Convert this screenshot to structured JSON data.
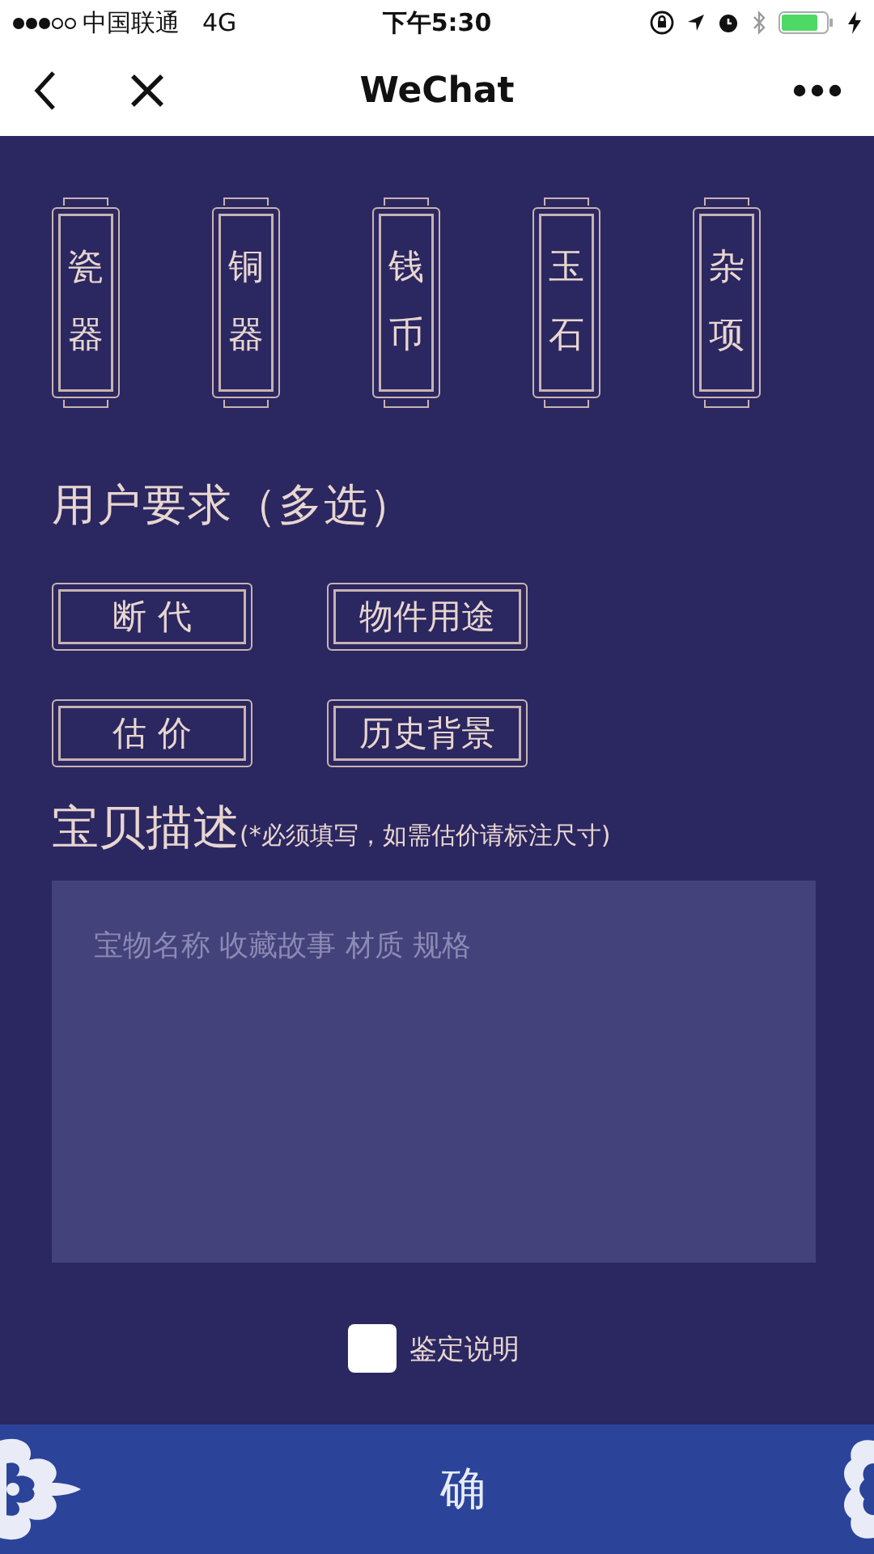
{
  "status_bar": {
    "carrier": "中国联通",
    "network": "4G",
    "time": "下午5:30"
  },
  "nav_bar": {
    "title": "WeChat"
  },
  "categories": [
    "瓷器",
    "铜器",
    "钱币",
    "玉石",
    "杂项"
  ],
  "requirements": {
    "title": "用户要求（多选）",
    "options": [
      "断 代",
      "物件用途",
      "估 价",
      "历史背景"
    ]
  },
  "description": {
    "title": "宝贝描述",
    "note": "(*必须填写，如需估价请标注尺寸)",
    "placeholder": "宝物名称 收藏故事 材质 规格"
  },
  "agreement": {
    "label": "鉴定说明",
    "checked": false
  },
  "submit": {
    "label": "确"
  }
}
